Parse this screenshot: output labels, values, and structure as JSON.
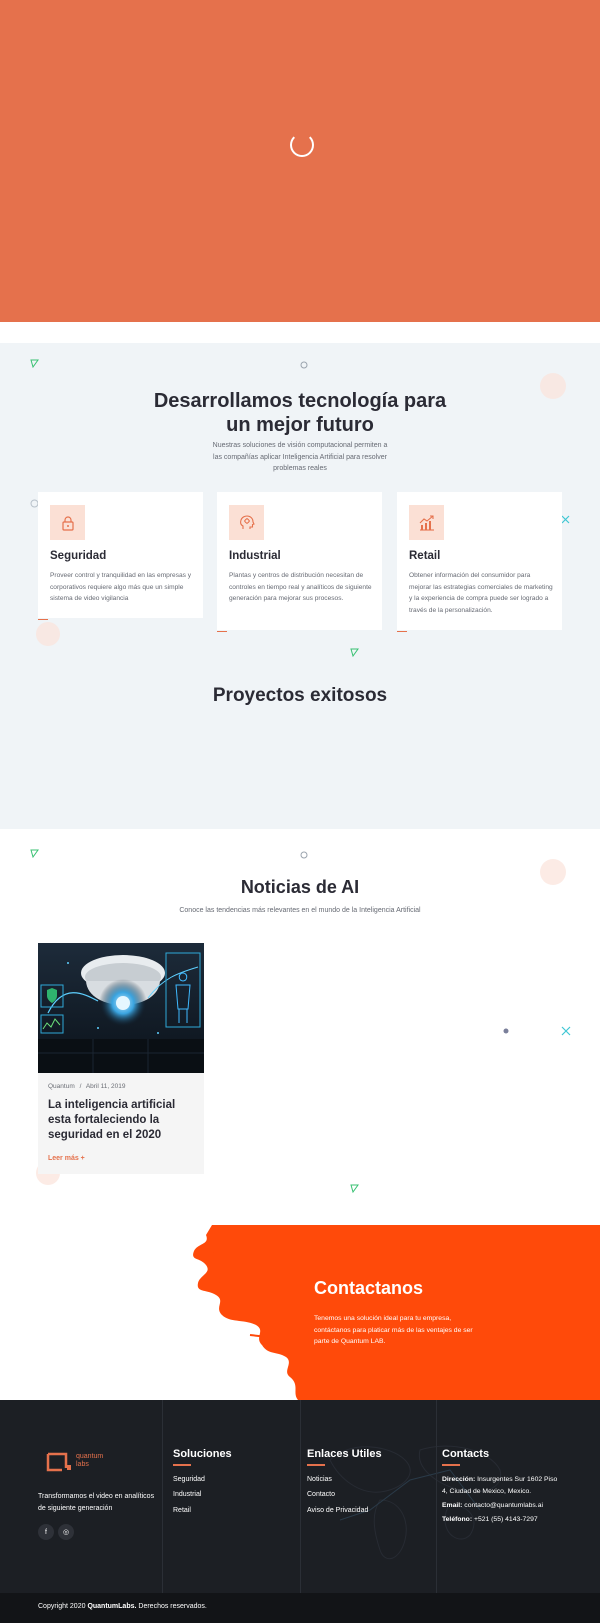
{
  "colors": {
    "accent": "#e5714c",
    "contact_bg": "#ff4a0a",
    "footer_bg": "#1c1f24",
    "section_bg": "#f0f4f7"
  },
  "hero": {
    "loader_icon": "spinner-icon"
  },
  "tech": {
    "title": "Desarrollamos tecnología para un mejor futuro",
    "subtitle": "Nuestras soluciones de visión computacional permiten a las compañías aplicar Inteligencia Artificial para resolver problemas reales",
    "cards": [
      {
        "icon": "lock-icon",
        "title": "Seguridad",
        "text": "Proveer control y tranquilidad en las empresas y corporativos requiere algo más que un simple sistema de video vigilancia"
      },
      {
        "icon": "ai-head-icon",
        "title": "Industrial",
        "text": "Plantas y centros de distribución necesitan de controles en tiempo real y analíticos de siguiente generación para mejorar sus procesos."
      },
      {
        "icon": "growth-chart-icon",
        "title": "Retail",
        "text": "Obtener información del consumidor para mejorar las estrategias comerciales de marketing y la experiencia de compra puede ser logrado a través de la personalización."
      }
    ],
    "projects_title": "Proyectos exitosos"
  },
  "news": {
    "title": "Noticias de AI",
    "subtitle": "Conoce las tendencias más relevantes en el mundo de la Inteligencia Artificial",
    "article": {
      "author": "Quantum",
      "separator": "/",
      "date": "Abril 11, 2019",
      "title": "La inteligencia artificial esta fortaleciendo la seguridad en el 2020",
      "more": "Leer más +"
    }
  },
  "contact": {
    "title": "Contactanos",
    "text": "Tenemos una solución ideal para tu empresa, contáctanos para platicar más de las ventajes de ser parte de Quantum LAB."
  },
  "footer": {
    "brand_line1": "quantum",
    "brand_line2": "labs",
    "tagline": "Transformamos el video en analíticos de siguiente generación",
    "social": [
      "f",
      "◎"
    ],
    "soluciones": {
      "title": "Soluciones",
      "links": [
        "Seguridad",
        "Industrial",
        "Retail"
      ]
    },
    "enlaces": {
      "title": "Enlaces Utiles",
      "links": [
        "Noticias",
        "Contacto",
        "Aviso de Privacidad"
      ]
    },
    "contacts": {
      "title": "Contacts",
      "address_label": "Dirección:",
      "address": "Insurgentes Sur 1602 Piso 4, Ciudad de Mexico, Mexico.",
      "email_label": "Email:",
      "email": "contacto@quantumlabs.ai",
      "phone_label": "Teléfono:",
      "phone": "+521 (55) 4143-7297"
    }
  },
  "copyright": {
    "prefix": "Copyright 2020",
    "brand": "QuantumLabs.",
    "suffix": "Derechos reservados."
  }
}
